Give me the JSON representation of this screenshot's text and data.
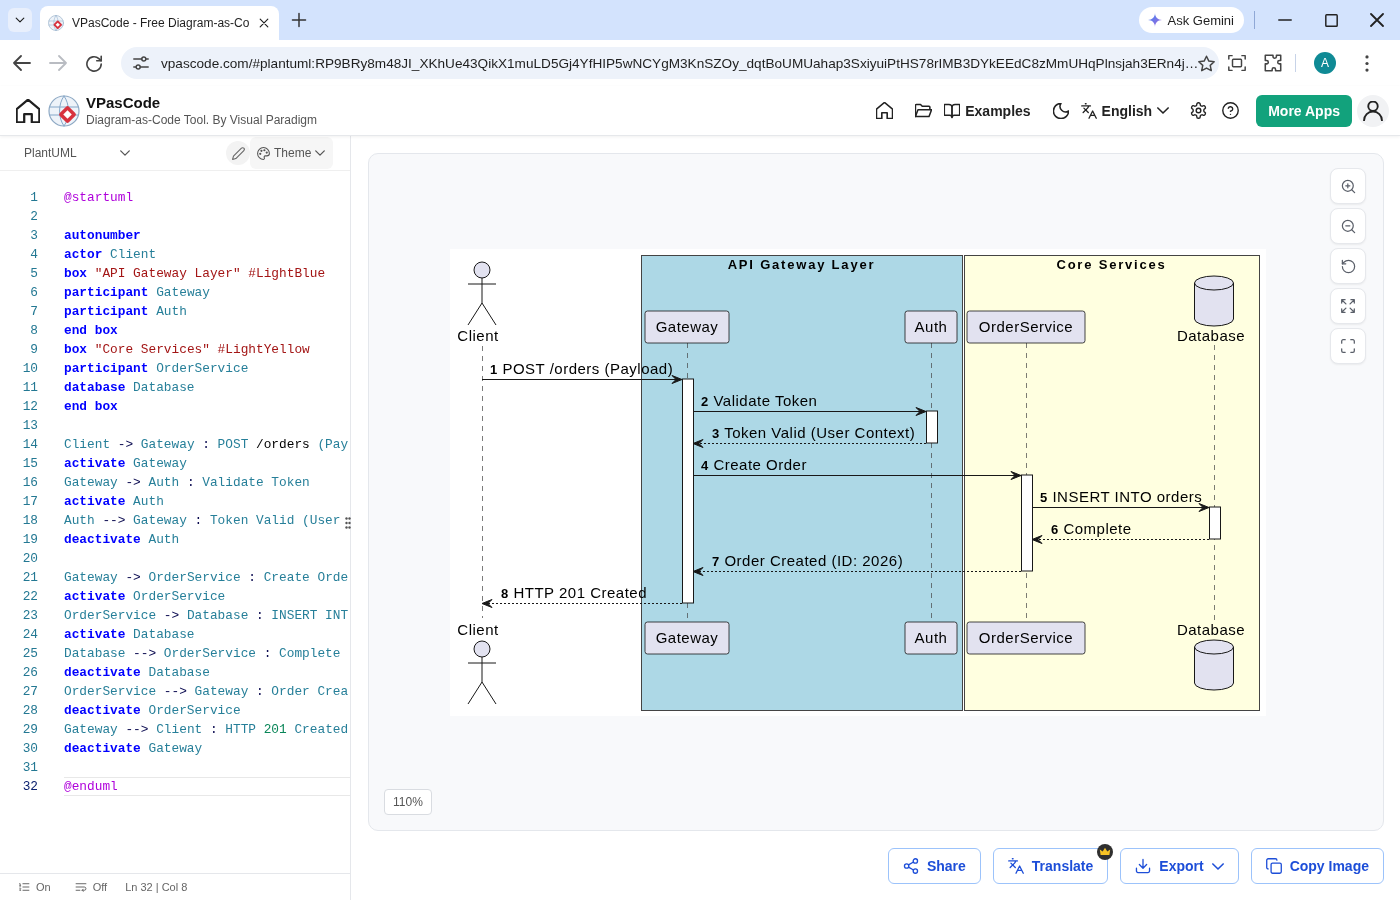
{
  "browser": {
    "tabs": [
      {
        "title": "VPasCode - Free Diagram-as-Co",
        "selected": true
      }
    ],
    "ask_gemini": "Ask Gemini",
    "url": "vpascode.com/#plantuml:RP9BRy8m48JI_XKhUe43QikX1muLD5Gj4YfHIP5wNCYgM3KnSZOy_dqtBoUMUahap3SxiyuiPtHS78rIMB3DYkEEdC8zMmUHqPlnsjah3ERn4j…",
    "profile_initial": "A"
  },
  "header": {
    "app_name": "VPasCode",
    "tagline": "Diagram-as-Code Tool. By Visual Paradigm",
    "examples": "Examples",
    "language": "English",
    "more_apps": "More Apps"
  },
  "editor": {
    "language": "PlantUML",
    "theme": "Theme",
    "lines": [
      {
        "number": "1",
        "current": false,
        "tokens": [
          {
            "text": "@startuml",
            "kind": "directive"
          }
        ]
      },
      {
        "number": "2",
        "current": false
      },
      {
        "number": "3",
        "current": false,
        "tokens": [
          {
            "text": "autonumber",
            "kind": "keyword"
          }
        ]
      },
      {
        "number": "4",
        "current": false,
        "tokens": [
          {
            "text": "actor",
            "kind": "keyword"
          },
          {
            "text": " Client",
            "kind": "ident"
          }
        ]
      },
      {
        "number": "5",
        "current": false,
        "tokens": [
          {
            "text": "box",
            "kind": "keyword"
          },
          {
            "text": " \"API Gateway Layer\"",
            "kind": "string"
          },
          {
            "text": " #LightBlue",
            "kind": "color"
          }
        ]
      },
      {
        "number": "6",
        "current": false,
        "tokens": [
          {
            "text": "participant",
            "kind": "keyword"
          },
          {
            "text": " Gateway",
            "kind": "ident"
          }
        ]
      },
      {
        "number": "7",
        "current": false,
        "tokens": [
          {
            "text": "participant",
            "kind": "keyword"
          },
          {
            "text": " Auth",
            "kind": "ident"
          }
        ]
      },
      {
        "number": "8",
        "current": false,
        "tokens": [
          {
            "text": "end box",
            "kind": "keyword"
          }
        ]
      },
      {
        "number": "9",
        "current": false,
        "tokens": [
          {
            "text": "box",
            "kind": "keyword"
          },
          {
            "text": " \"Core Services\"",
            "kind": "string"
          },
          {
            "text": " #LightYellow",
            "kind": "color"
          }
        ]
      },
      {
        "number": "10",
        "current": false,
        "tokens": [
          {
            "text": "participant",
            "kind": "keyword"
          },
          {
            "text": " OrderService",
            "kind": "ident"
          }
        ]
      },
      {
        "number": "11",
        "current": false,
        "tokens": [
          {
            "text": "database",
            "kind": "keyword"
          },
          {
            "text": " Database",
            "kind": "ident"
          }
        ]
      },
      {
        "number": "12",
        "current": false,
        "tokens": [
          {
            "text": "end box",
            "kind": "keyword"
          }
        ]
      },
      {
        "number": "13",
        "current": false
      },
      {
        "number": "14",
        "current": false,
        "tokens": [
          {
            "text": "Client",
            "kind": "ident"
          },
          {
            "text": " ->",
            "kind": "op"
          },
          {
            "text": " Gateway",
            "kind": "ident"
          },
          {
            "text": " :",
            "kind": "op"
          },
          {
            "text": " POST",
            "kind": "ident"
          },
          {
            "text": " /orders",
            "kind": "plain"
          },
          {
            "text": " (Pay",
            "kind": "ident"
          }
        ]
      },
      {
        "number": "15",
        "current": false,
        "tokens": [
          {
            "text": "activate",
            "kind": "keyword"
          },
          {
            "text": " Gateway",
            "kind": "ident"
          }
        ]
      },
      {
        "number": "16",
        "current": false,
        "tokens": [
          {
            "text": "Gateway",
            "kind": "ident"
          },
          {
            "text": " ->",
            "kind": "op"
          },
          {
            "text": " Auth",
            "kind": "ident"
          },
          {
            "text": " :",
            "kind": "op"
          },
          {
            "text": " Validate Token",
            "kind": "ident"
          }
        ]
      },
      {
        "number": "17",
        "current": false,
        "tokens": [
          {
            "text": "activate",
            "kind": "keyword"
          },
          {
            "text": " Auth",
            "kind": "ident"
          }
        ]
      },
      {
        "number": "18",
        "current": false,
        "tokens": [
          {
            "text": "Auth",
            "kind": "ident"
          },
          {
            "text": " -->",
            "kind": "op"
          },
          {
            "text": " Gateway",
            "kind": "ident"
          },
          {
            "text": " :",
            "kind": "op"
          },
          {
            "text": " Token Valid (User",
            "kind": "ident"
          }
        ]
      },
      {
        "number": "19",
        "current": false,
        "tokens": [
          {
            "text": "deactivate",
            "kind": "keyword"
          },
          {
            "text": " Auth",
            "kind": "ident"
          }
        ]
      },
      {
        "number": "20",
        "current": false
      },
      {
        "number": "21",
        "current": false,
        "tokens": [
          {
            "text": "Gateway",
            "kind": "ident"
          },
          {
            "text": " ->",
            "kind": "op"
          },
          {
            "text": " OrderService",
            "kind": "ident"
          },
          {
            "text": " :",
            "kind": "op"
          },
          {
            "text": " Create Orde",
            "kind": "ident"
          }
        ]
      },
      {
        "number": "22",
        "current": false,
        "tokens": [
          {
            "text": "activate",
            "kind": "keyword"
          },
          {
            "text": " OrderService",
            "kind": "ident"
          }
        ]
      },
      {
        "number": "23",
        "current": false,
        "tokens": [
          {
            "text": "OrderService",
            "kind": "ident"
          },
          {
            "text": " ->",
            "kind": "op"
          },
          {
            "text": " Database",
            "kind": "ident"
          },
          {
            "text": " :",
            "kind": "op"
          },
          {
            "text": " INSERT INT",
            "kind": "ident"
          }
        ]
      },
      {
        "number": "24",
        "current": false,
        "tokens": [
          {
            "text": "activate",
            "kind": "keyword"
          },
          {
            "text": " Database",
            "kind": "ident"
          }
        ]
      },
      {
        "number": "25",
        "current": false,
        "tokens": [
          {
            "text": "Database",
            "kind": "ident"
          },
          {
            "text": " -->",
            "kind": "op"
          },
          {
            "text": " OrderService",
            "kind": "ident"
          },
          {
            "text": " :",
            "kind": "op"
          },
          {
            "text": " Complete",
            "kind": "ident"
          }
        ]
      },
      {
        "number": "26",
        "current": false,
        "tokens": [
          {
            "text": "deactivate",
            "kind": "keyword"
          },
          {
            "text": " Database",
            "kind": "ident"
          }
        ]
      },
      {
        "number": "27",
        "current": false,
        "tokens": [
          {
            "text": "OrderService",
            "kind": "ident"
          },
          {
            "text": " -->",
            "kind": "op"
          },
          {
            "text": " Gateway",
            "kind": "ident"
          },
          {
            "text": " :",
            "kind": "op"
          },
          {
            "text": " Order Crea",
            "kind": "ident"
          }
        ]
      },
      {
        "number": "28",
        "current": false,
        "tokens": [
          {
            "text": "deactivate",
            "kind": "keyword"
          },
          {
            "text": " OrderService",
            "kind": "ident"
          }
        ]
      },
      {
        "number": "29",
        "current": false,
        "tokens": [
          {
            "text": "Gateway",
            "kind": "ident"
          },
          {
            "text": " -->",
            "kind": "op"
          },
          {
            "text": " Client",
            "kind": "ident"
          },
          {
            "text": " :",
            "kind": "op"
          },
          {
            "text": " HTTP",
            "kind": "ident"
          },
          {
            "text": " 201",
            "kind": "number"
          },
          {
            "text": " Created",
            "kind": "ident"
          }
        ]
      },
      {
        "number": "30",
        "current": false,
        "tokens": [
          {
            "text": "deactivate",
            "kind": "keyword"
          },
          {
            "text": " Gateway",
            "kind": "ident"
          }
        ]
      },
      {
        "number": "31",
        "current": false
      },
      {
        "number": "32",
        "current": true,
        "tokens": [
          {
            "text": "@enduml",
            "kind": "directive"
          }
        ]
      }
    ],
    "status": {
      "line_numbers": "On",
      "word_wrap": "Off",
      "cursor_position": "Ln 32 | Col 8"
    }
  },
  "canvas": {
    "diagram": {
      "boxes": [
        {
          "title": "API Gateway Layer",
          "color": "#add8e6"
        },
        {
          "title": "Core Services",
          "color": "#ffffe0"
        }
      ],
      "participants": [
        {
          "kind": "actor",
          "top_label": "Client",
          "bottom_label": "Client"
        },
        {
          "kind": "participant",
          "top_label": "Gateway",
          "bottom_label": "Gateway"
        },
        {
          "kind": "participant",
          "top_label": "Auth",
          "bottom_label": "Auth"
        },
        {
          "kind": "participant",
          "top_label": "OrderService",
          "bottom_label": "OrderService"
        },
        {
          "kind": "database",
          "top_label": "Database",
          "bottom_label": "Database"
        }
      ],
      "messages": [
        {
          "number": "1",
          "text": "POST /orders (Payload)",
          "kind": "sync"
        },
        {
          "number": "2",
          "text": "Validate Token",
          "kind": "sync"
        },
        {
          "number": "3",
          "text": "Token Valid (User Context)",
          "kind": "reply"
        },
        {
          "number": "4",
          "text": "Create Order",
          "kind": "sync"
        },
        {
          "number": "5",
          "text": "INSERT INTO orders",
          "kind": "sync"
        },
        {
          "number": "6",
          "text": "Complete",
          "kind": "reply"
        },
        {
          "number": "7",
          "text": "Order Created (ID: 2026)",
          "kind": "reply"
        },
        {
          "number": "8",
          "text": "HTTP 201 Created",
          "kind": "reply"
        }
      ]
    },
    "zoom_level": "110%"
  },
  "actions": [
    {
      "label": "Share",
      "kind": "share",
      "premium": false
    },
    {
      "label": "Translate",
      "kind": "translate",
      "premium": true
    },
    {
      "label": "Export",
      "kind": "export",
      "premium": false
    },
    {
      "label": "Copy Image",
      "kind": "copy",
      "premium": false
    }
  ]
}
